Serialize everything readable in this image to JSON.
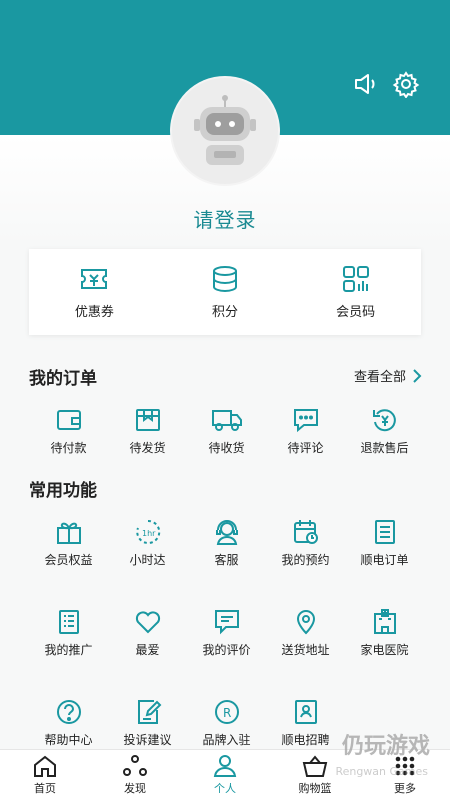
{
  "header": {
    "login_prompt": "请登录"
  },
  "cards": [
    {
      "label": "优惠券",
      "icon": "coupon-icon"
    },
    {
      "label": "积分",
      "icon": "points-icon"
    },
    {
      "label": "会员码",
      "icon": "member-code-icon"
    }
  ],
  "orders": {
    "title": "我的订单",
    "see_all": "查看全部",
    "items": [
      {
        "label": "待付款",
        "icon": "wallet-icon"
      },
      {
        "label": "待发货",
        "icon": "package-icon"
      },
      {
        "label": "待收货",
        "icon": "truck-icon"
      },
      {
        "label": "待评论",
        "icon": "comment-icon"
      },
      {
        "label": "退款售后",
        "icon": "refund-icon"
      }
    ]
  },
  "functions": {
    "title": "常用功能",
    "items": [
      {
        "label": "会员权益",
        "icon": "gift-icon"
      },
      {
        "label": "小时达",
        "icon": "hour-delivery-icon"
      },
      {
        "label": "客服",
        "icon": "headset-icon"
      },
      {
        "label": "我的预约",
        "icon": "calendar-icon"
      },
      {
        "label": "顺电订单",
        "icon": "order-list-icon"
      },
      {
        "label": "我的推广",
        "icon": "promotion-icon"
      },
      {
        "label": "最爱",
        "icon": "heart-icon"
      },
      {
        "label": "我的评价",
        "icon": "review-icon"
      },
      {
        "label": "送货地址",
        "icon": "location-icon"
      },
      {
        "label": "家电医院",
        "icon": "hospital-icon"
      },
      {
        "label": "帮助中心",
        "icon": "help-icon"
      },
      {
        "label": "投诉建议",
        "icon": "feedback-icon"
      },
      {
        "label": "品牌入驻",
        "icon": "brand-icon"
      },
      {
        "label": "顺电招聘",
        "icon": "recruit-icon"
      }
    ]
  },
  "tabs": [
    {
      "label": "首页",
      "icon": "home-icon",
      "active": false
    },
    {
      "label": "发现",
      "icon": "discover-icon",
      "active": false
    },
    {
      "label": "个人",
      "icon": "profile-icon",
      "active": true
    },
    {
      "label": "购物篮",
      "icon": "basket-icon",
      "active": false
    },
    {
      "label": "更多",
      "icon": "more-icon",
      "active": false
    }
  ],
  "watermark": {
    "title": "仍玩游戏",
    "subtitle": "Rengwan Games"
  },
  "colors": {
    "primary": "#1a98a1",
    "text": "#222222",
    "background": "#f7f8f8"
  }
}
